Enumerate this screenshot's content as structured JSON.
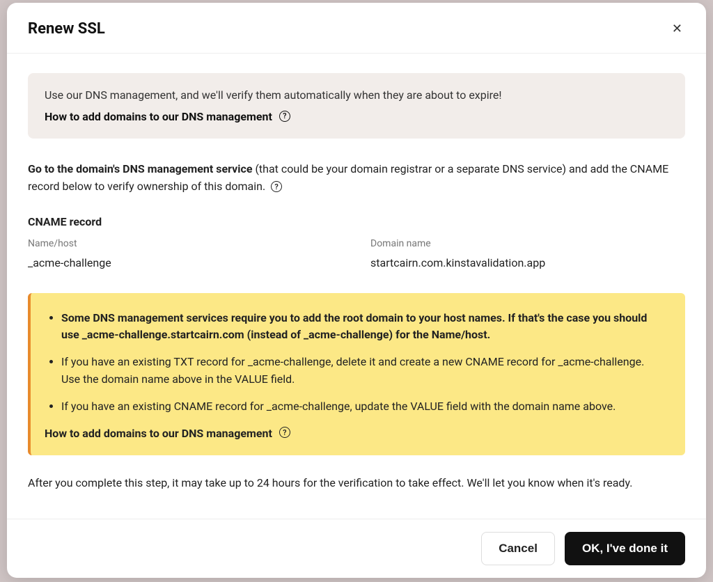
{
  "modal": {
    "title": "Renew SSL",
    "info_panel": {
      "text": "Use our DNS management, and we'll verify them automatically when they are about to expire!",
      "link": "How to add domains to our DNS management"
    },
    "instructions": {
      "bold": "Go to the domain's DNS management service",
      "rest": " (that could be your domain registrar or a separate DNS service) and add the CNAME record below to verify ownership of this domain. "
    },
    "cname": {
      "heading": "CNAME record",
      "name_label": "Name/host",
      "name_value": "_acme-challenge",
      "domain_label": "Domain name",
      "domain_value": "startcairn.com.kinstavalidation.app"
    },
    "warning": {
      "items": [
        "Some DNS management services require you to add the root domain to your host names. If that's the case you should use _acme-challenge.startcairn.com (instead of _acme-challenge) for the Name/host.",
        "If you have an existing TXT record for _acme-challenge, delete it and create a new CNAME record for _acme-challenge. Use the domain name above in the VALUE field.",
        "If you have an existing CNAME record for _acme-challenge, update the VALUE field with the domain name above."
      ],
      "link": "How to add domains to our DNS management"
    },
    "footnote": "After you complete this step, it may take up to 24 hours for the verification to take effect. We'll let you know when it's ready.",
    "buttons": {
      "cancel": "Cancel",
      "ok": "OK, I've done it"
    }
  }
}
